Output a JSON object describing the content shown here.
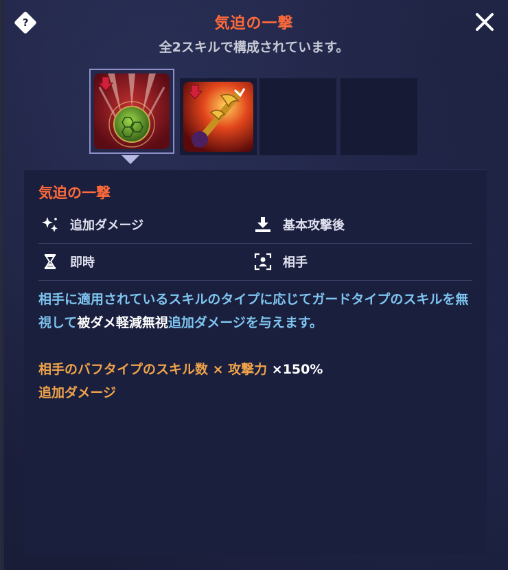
{
  "header": {
    "title": "気迫の一撃",
    "subtitle": "全2スキルで構成されています。"
  },
  "icons": {
    "help": "help-diamond-icon",
    "close": "close-icon"
  },
  "help_glyph": "?",
  "slots": [
    {
      "state": "selected",
      "icon": "green-orb-skill-icon"
    },
    {
      "state": "normal",
      "icon": "golden-weapon-skill-icon"
    },
    {
      "state": "empty"
    },
    {
      "state": "empty"
    }
  ],
  "detail": {
    "skill_name": "気迫の一撃",
    "attributes": [
      {
        "icon": "sparkle-icon",
        "label": "追加ダメージ"
      },
      {
        "icon": "download-tray-icon",
        "label": "基本攻撃後"
      },
      {
        "icon": "hourglass-icon",
        "label": "即時"
      },
      {
        "icon": "target-person-icon",
        "label": "相手"
      }
    ],
    "description": {
      "part1": "相手に適用されているスキルのタイプに応じてガードタイプのスキルを無視して",
      "highlight": "被ダメ軽減無視",
      "part2": "追加ダメージを与えます。"
    },
    "formula": {
      "expr": "相手のバフタイプのスキル数 × 攻撃力",
      "mult": " ×150%",
      "effect": "追加ダメージ"
    }
  },
  "colors": {
    "accent": "#ff6a3a",
    "description": "#7ec5f0",
    "formula": "#f0a44a",
    "panel": "#1b1f3e"
  }
}
